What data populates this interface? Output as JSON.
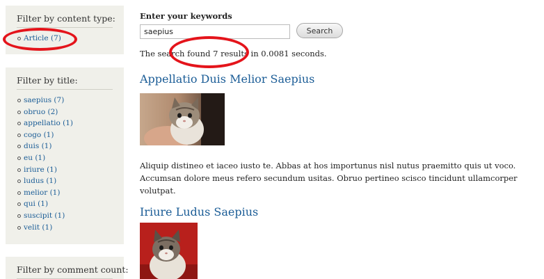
{
  "sidebar": {
    "content_type": {
      "title": "Filter by content type:",
      "items": [
        {
          "label": "Article (7)"
        }
      ]
    },
    "by_title": {
      "title": "Filter by title:",
      "items": [
        {
          "label": "saepius (7)"
        },
        {
          "label": "obruo (2)"
        },
        {
          "label": "appellatio (1)"
        },
        {
          "label": "cogo (1)"
        },
        {
          "label": "duis (1)"
        },
        {
          "label": "eu (1)"
        },
        {
          "label": "iriure (1)"
        },
        {
          "label": "ludus (1)"
        },
        {
          "label": "melior (1)"
        },
        {
          "label": "qui (1)"
        },
        {
          "label": "suscipit (1)"
        },
        {
          "label": "velit (1)"
        }
      ]
    },
    "comment_count": {
      "title": "Filter by comment count:"
    }
  },
  "search": {
    "label": "Enter your keywords",
    "value": "saepius",
    "button_label": "Search",
    "summary": "The search found 7 results in 0.0081 seconds."
  },
  "results": [
    {
      "title": "Appellatio Duis Melior Saepius",
      "snippet": "Aliquip distineo et iaceo iusto te. Abbas at hos importunus nisl nutus praemitto quis ut voco. Accumsan dolore meus refero secundum usitas. Obruo pertineo scisco tincidunt ullamcorper volutpat.",
      "image_icon": "kitten-photo"
    },
    {
      "title": "Iriure Ludus Saepius",
      "image_icon": "kitten-photo"
    }
  ],
  "annotation_color": "#e4141b",
  "link_color": "#1a5c96"
}
